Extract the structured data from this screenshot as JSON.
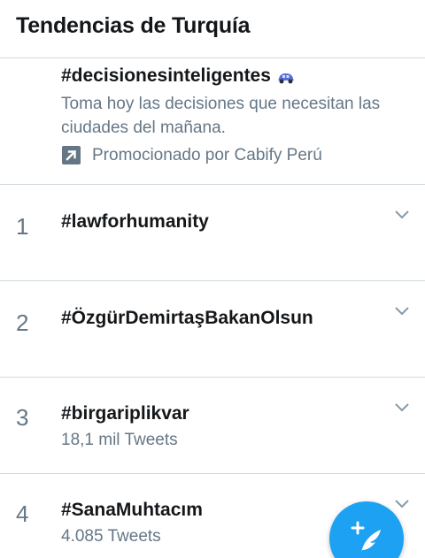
{
  "header": {
    "title": "Tendencias de Turquía"
  },
  "promoted": {
    "hashtag": "#decisionesinteligentes",
    "description": "Toma hoy las decisiones que necesitan las ciudades del mañana.",
    "promoted_by": "Promocionado por Cabify Perú",
    "emoji_icon": "car-icon"
  },
  "trends": [
    {
      "rank": "1",
      "name": "#lawforhumanity",
      "count": ""
    },
    {
      "rank": "2",
      "name": "#ÖzgürDemirtaşBakanOlsun",
      "count": ""
    },
    {
      "rank": "3",
      "name": "#birgariplikvar",
      "count": "18,1 mil Tweets"
    },
    {
      "rank": "4",
      "name": "#SanaMuhtacım",
      "count": "4.085 Tweets"
    }
  ],
  "colors": {
    "accent": "#1da1f2",
    "primary_text": "#14171a",
    "secondary_text": "#657786",
    "divider": "#cfd9de"
  }
}
